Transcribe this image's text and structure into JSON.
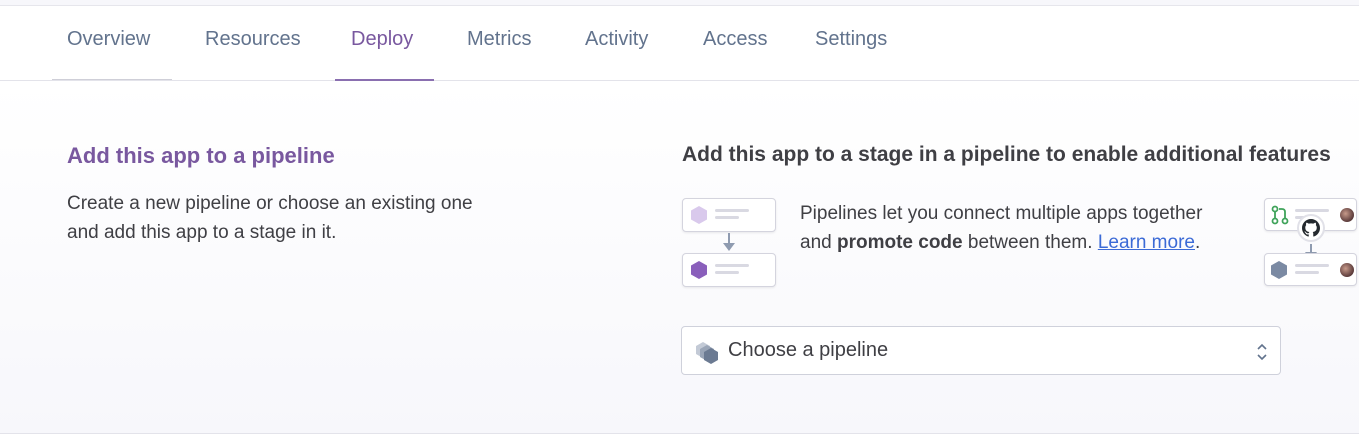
{
  "tabs": [
    {
      "label": "Overview"
    },
    {
      "label": "Resources"
    },
    {
      "label": "Deploy",
      "active": true
    },
    {
      "label": "Metrics"
    },
    {
      "label": "Activity"
    },
    {
      "label": "Access"
    },
    {
      "label": "Settings"
    }
  ],
  "pipeline": {
    "left_title": "Add this app to a pipeline",
    "left_description": "Create a new pipeline or choose an existing one and add this app to a stage in it.",
    "right_title": "Add this app to a stage in a pipeline to enable additional features",
    "desc_part1": "Pipelines let you connect multiple apps together and ",
    "desc_bold": "promote code",
    "desc_part2": " between them. ",
    "learn_more": "Learn more",
    "desc_end": ".",
    "select_placeholder": "Choose a pipeline"
  },
  "colors": {
    "accent_purple": "#79589f",
    "tab_gray": "#62738d",
    "link_blue": "#3b6ad6"
  },
  "icons": [
    "pipeline-stage-icon",
    "github-icon",
    "git-pull-request-icon",
    "pipeline-icon",
    "chevron-updown-icon"
  ]
}
